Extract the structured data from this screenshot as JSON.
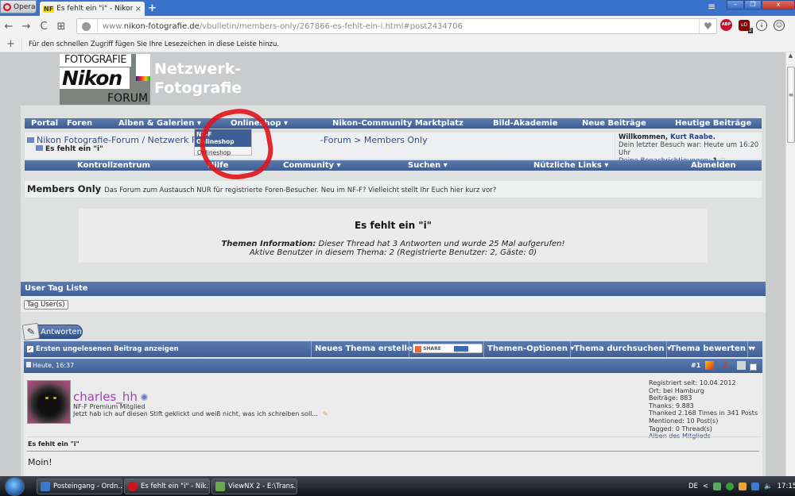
{
  "browser": {
    "menu_label": "Opera",
    "tab": {
      "favicon_text": "NF",
      "title": "Es fehlt ein \"i\" - Nikon Foto",
      "close": "×"
    },
    "new_tab": "+",
    "window_controls": {
      "menu": "≡",
      "minimize": "–",
      "restore": "❐",
      "close": "x"
    },
    "nav": {
      "back": "←",
      "forward": "→",
      "reload": "C",
      "speed_dial": "⊞"
    },
    "url": {
      "prefix": "www.",
      "domain": "nikon-fotografie.de",
      "path": "/vbulletin/members-only/267866-es-fehlt-ein-i.html#post2434706"
    },
    "extensions": [
      {
        "name": "adblock-plus",
        "label": "ABP"
      },
      {
        "name": "ublock",
        "label": "uD",
        "badge": "2"
      },
      {
        "name": "downloads",
        "label": "↓"
      },
      {
        "name": "account",
        "label": "☺"
      }
    ],
    "bookmarks_hint": "Für den schnellen Zugriff fügen Sie Ihre Lesezeichen in diese Leiste hinzu."
  },
  "site": {
    "logo": {
      "top": "FOTOGRAFIE",
      "middle": "Nikon",
      "bottom": "FORUM"
    },
    "name_line1": "Netzwerk-",
    "name_line2": "Fotografie"
  },
  "top_nav": [
    {
      "label": "Portal"
    },
    {
      "label": "Foren"
    },
    {
      "label": "Alben & Galerien ▾"
    },
    {
      "label": "Onlineshop ▾"
    },
    {
      "label": "Nikon-Community Marktplatz"
    },
    {
      "label": "Bild-Akademie"
    },
    {
      "label": "Neue Beiträge"
    },
    {
      "label": "Heutige Beiträge"
    }
  ],
  "dropdown": {
    "header": "NF-F Onlineshop",
    "item": "Onlineshop"
  },
  "breadcrumb": {
    "path": "Nikon Fotografie-Forum / Netzwerk Fotografie > ",
    "hidden_part": "Nikon Fotografie",
    "rest": "-Forum > Members Only",
    "current": "Es fehlt ein \"i\""
  },
  "welcome": {
    "greeting": "Willkommen, ",
    "user": "Kurt Raabe.",
    "last_visit": "Dein letzter Besuch war: Heute um 16:20 Uhr",
    "notifications_label": "Deine Benachrichtigungen: ",
    "notifications_count": "1"
  },
  "second_nav": [
    {
      "label": "Kontrollzentrum"
    },
    {
      "label": "Hilfe"
    },
    {
      "label": "Community ▾"
    },
    {
      "label": "Suchen ▾"
    },
    {
      "label": "Nützliche Links ▾"
    },
    {
      "label": "Abmelden"
    }
  ],
  "forum": {
    "name": "Members Only",
    "description": "Das Forum zum Austausch NUR für registrierte Foren-Besucher. Neu im NF-F? Vielleicht stellt Ihr Euch hier kurz vor?"
  },
  "thread": {
    "title": "Es fehlt ein \"i\"",
    "info_label": "Themen Information:",
    "info_text": " Dieser Thread hat 3 Antworten und wurde 25 Mal aufgerufen!",
    "active_users": "Aktive Benutzer in diesem Thema: 2 (Registrierte Benutzer: 2, Gäste: 0)"
  },
  "user_tags": {
    "header": "User Tag Liste",
    "button": "Tag User(s)"
  },
  "reply_button": "Antworten",
  "thread_tools": {
    "first_unread": "Ersten ungelesenen Beitrag anzeigen",
    "new_thread": "Neues Thema erstellen",
    "share": "SHARE",
    "options": "Themen-Optionen ▾",
    "search": "Thema durchsuchen ▾",
    "rate": "Thema bewerten ▾",
    "more": "▾"
  },
  "post": {
    "date": "Heute, 16:37",
    "number": "#1",
    "username": "charles_hh",
    "user_title": "NF-F Premium Mitglied",
    "status": "Jetzt hab ich auf diesen Stift geklickt und weiß nicht, was ich schreiben soll...",
    "stats": [
      "Registriert seit: 10.04.2012",
      "Ort: bei Hamburg",
      "Beiträge: 883",
      "Thanks: 9.883",
      "Thanked 2.168 Times in 341 Posts",
      "Mentioned: 10 Post(s)",
      "Tagged: 0 Thread(s)"
    ],
    "albums_link": "Alben des Mitglieds",
    "title": "Es fehlt ein \"i\"",
    "body": "Moin!"
  },
  "taskbar": {
    "tasks": [
      {
        "label": "Posteingang - Ordn...",
        "color": "#3b78c9"
      },
      {
        "label": "Es fehlt ein \"i\" - Nik...",
        "color": "#d0141b"
      },
      {
        "label": "ViewNX 2 - E:\\Trans...",
        "color": "#6aa84f"
      }
    ],
    "language": "DE",
    "tray_expand": "<",
    "clock": "17:15"
  }
}
